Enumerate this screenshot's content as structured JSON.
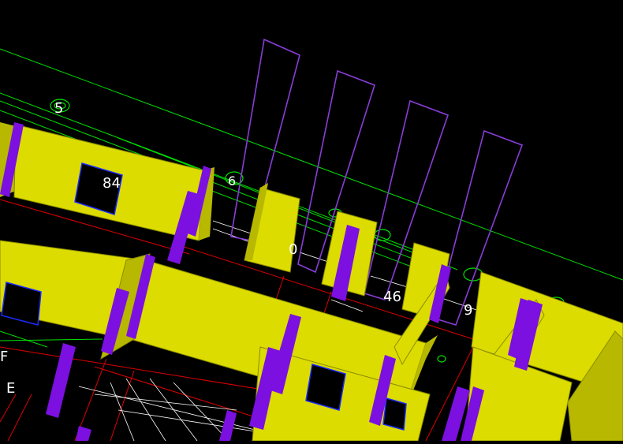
{
  "viewport": {
    "background": "#000000",
    "colors": {
      "wall_face": "#dcdc00",
      "wall_side": "#b8b800",
      "wall_edge": "#8a8a00",
      "column": "#7b10e0",
      "column_dark": "#5a08a8",
      "axis_green": "#00e000",
      "frame_purple": "#8a3dd8",
      "red_line": "#e00000",
      "white_line": "#ffffff",
      "window_fill": "#000000",
      "window_edge": "#1a2cff",
      "label": "#ffffff"
    },
    "labels": {
      "axis_5": "5",
      "axis_6": "6",
      "room_84": "84",
      "room_0": "0",
      "room_46": "46",
      "room_9": "9",
      "edge_f": "F",
      "edge_e": "E"
    }
  }
}
